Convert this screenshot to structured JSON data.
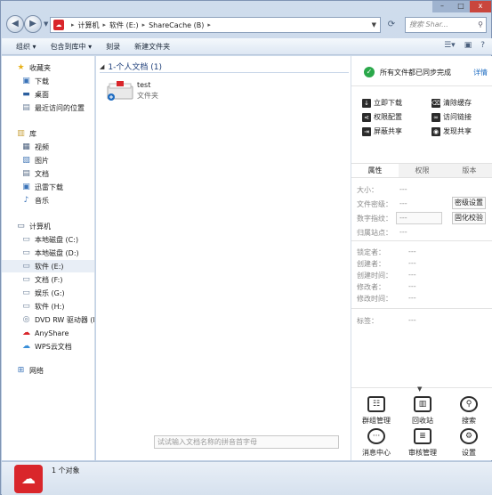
{
  "window": {
    "controls": {
      "minimize": "–",
      "maximize": "□",
      "close": "x"
    }
  },
  "address": {
    "crumbs": [
      "计算机",
      "软件 (E:)",
      "ShareCache (B)"
    ],
    "search_placeholder": "搜索 Shar..."
  },
  "toolbar": {
    "organize": "组织 ▾",
    "include_in_library": "包含到库中 ▾",
    "burn": "刻录",
    "new_folder": "新建文件夹"
  },
  "nav": {
    "favorites": "收藏夹",
    "downloads": "下载",
    "desktop": "桌面",
    "recent": "最近访问的位置",
    "libraries": "库",
    "videos": "视频",
    "pictures": "图片",
    "documents": "文档",
    "thunder": "迅雷下载",
    "music": "音乐",
    "computer": "计算机",
    "drive_c": "本地磁盘 (C:)",
    "drive_d": "本地磁盘 (D:)",
    "drive_e": "软件 (E:)",
    "drive_f": "文档 (F:)",
    "drive_g": "娱乐 (G:)",
    "drive_h": "软件 (H:)",
    "dvd": "DVD RW 驱动器 (I:",
    "anyshare": "AnyShare",
    "wps": "WPS云文档",
    "network": "网络"
  },
  "list": {
    "group_header": "1-个人文档 (1)",
    "items": [
      {
        "name": "test",
        "type": "文件夹"
      }
    ],
    "pinyin_placeholder": "试试输入文档名称的拼音首字母"
  },
  "panel": {
    "sync_status": "所有文件都已同步完成",
    "details_link": "详情",
    "actions": {
      "download_now": "立即下载",
      "clear_cache": "清除缓存",
      "permission_config": "权限配置",
      "access_link": "访问链接",
      "block_share": "屏蔽共享",
      "discover_share": "发现共享"
    },
    "tabs": [
      "属性",
      "权限",
      "版本"
    ],
    "props": {
      "size_label": "大小：",
      "size_value": "---",
      "security_label": "文件密级：",
      "security_value": "---",
      "fingerprint_label": "数字指纹：",
      "fingerprint_value": "---",
      "site_label": "归属站点：",
      "site_value": "---",
      "locker_label": "锁定者：",
      "locker_value": "---",
      "creator_label": "创建者：",
      "creator_value": "---",
      "created_label": "创建时间：",
      "created_value": "---",
      "modifier_label": "修改者：",
      "modifier_value": "---",
      "modified_label": "修改时间：",
      "modified_value": "---",
      "tags_label": "标签：",
      "tags_value": "---"
    },
    "buttons": {
      "security_settings": "密级设置",
      "fix_check": "固化校验"
    },
    "grid": {
      "group_mgmt": "群组管理",
      "recycle": "回收站",
      "search": "搜索",
      "messages": "消息中心",
      "review": "审核管理",
      "settings": "设置"
    }
  },
  "status": {
    "count": "1 个对象"
  },
  "colors": {
    "accent": "#d9262b",
    "link": "#1f6dc2",
    "ok": "#2aa84a"
  }
}
